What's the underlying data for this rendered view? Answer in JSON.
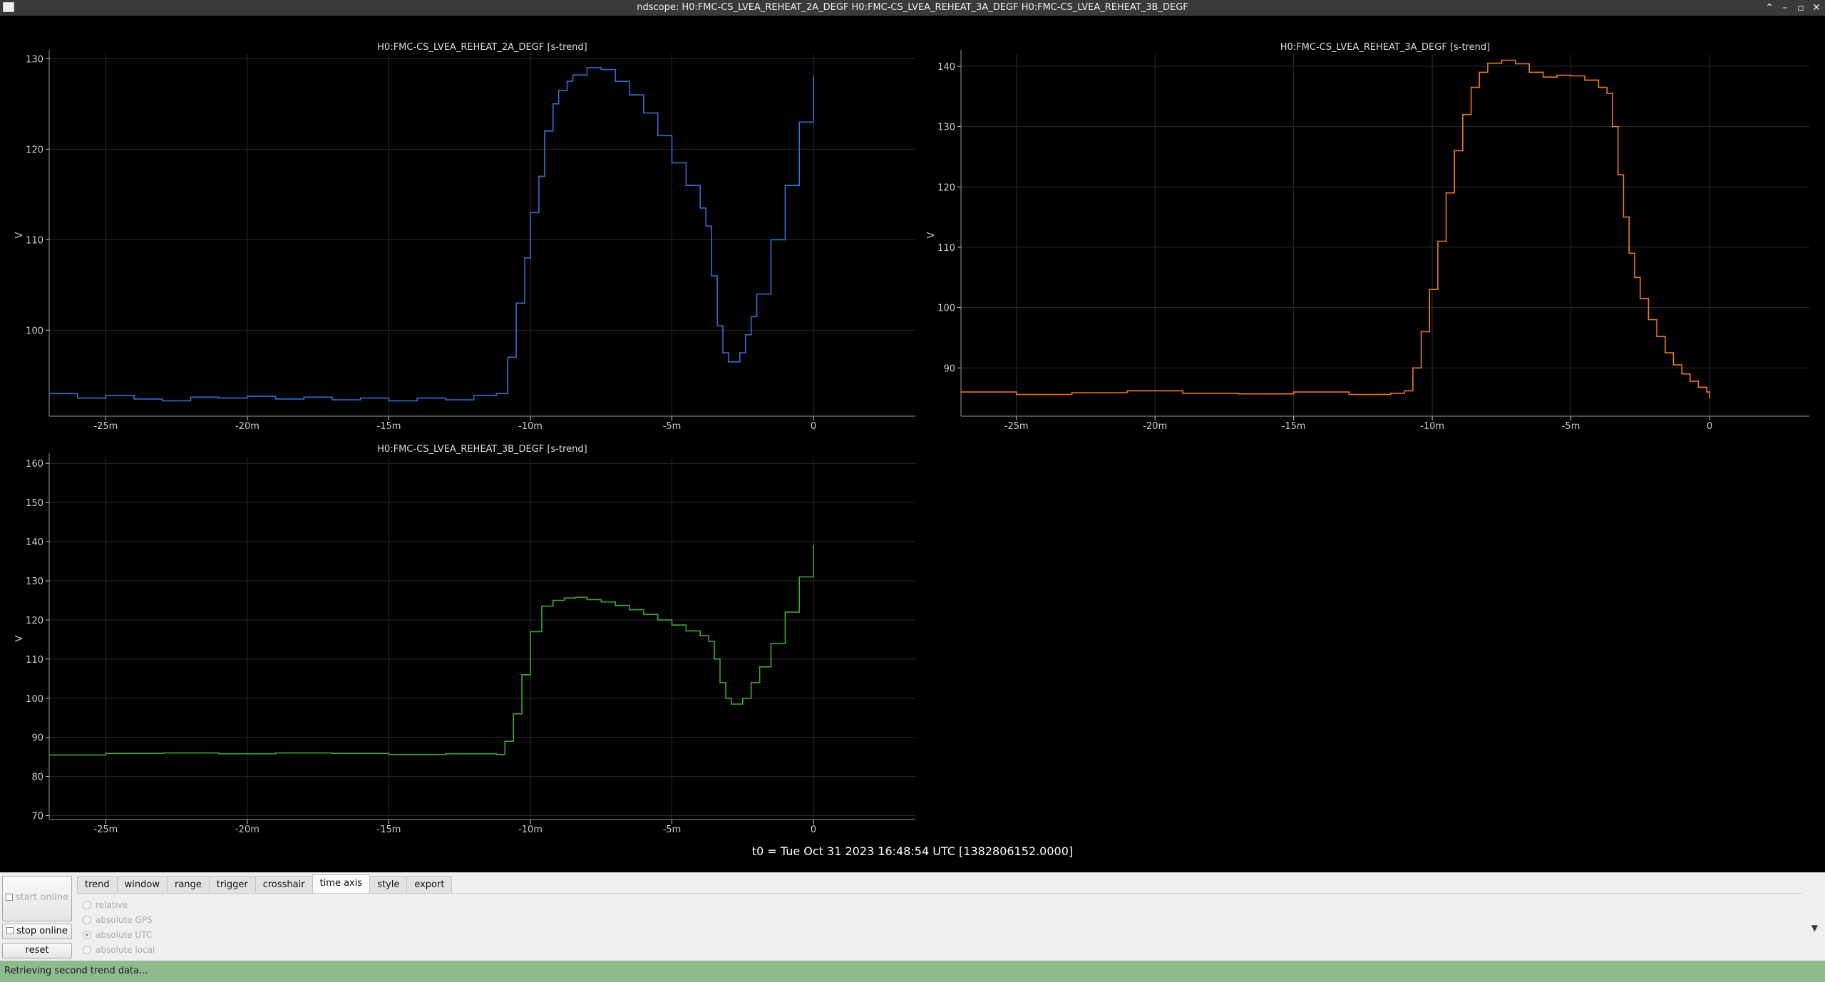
{
  "window": {
    "title": "ndscope: H0:FMC-CS_LVEA_REHEAT_2A_DEGF H0:FMC-CS_LVEA_REHEAT_3A_DEGF H0:FMC-CS_LVEA_REHEAT_3B_DEGF",
    "minimize_glyph": "–",
    "maximize_glyph": "▫",
    "close_glyph": "✕",
    "shade_glyph": "⌃"
  },
  "t0_label": "t0 = Tue Oct 31 2023 16:48:54 UTC [1382806152.0000]",
  "controls": {
    "start_online": "start online",
    "stop_online": "stop online",
    "reset": "reset",
    "tabs": [
      "trend",
      "window",
      "range",
      "trigger",
      "crosshair",
      "time axis",
      "style",
      "export"
    ],
    "active_tab": "time axis",
    "time_axis_options": [
      "relative",
      "absolute GPS",
      "absolute UTC",
      "absolute local"
    ],
    "selected_option": "absolute UTC",
    "collapse_glyph": "▼"
  },
  "status": "Retrieving second trend data...",
  "colors": {
    "plot_bg": "#000000",
    "grid": "#2a2a2a",
    "axis_text": "#cccccc",
    "trace_2a": "#2f6fd1",
    "trace_3a": "#ea7a1c",
    "trace_3b": "#3ea830",
    "status_bg": "#8fba8e"
  },
  "chart_data": [
    {
      "type": "line",
      "title": "H0:FMC-CS_LVEA_REHEAT_2A_DEGF [s-trend]",
      "ylabel": "V",
      "xlabel": "",
      "x_unit": "minutes",
      "xlim": [
        -27,
        3.6
      ],
      "ylim": [
        90.5,
        130.5
      ],
      "xticks": [
        -25,
        -20,
        -15,
        -10,
        -5,
        0
      ],
      "xtick_labels": [
        "-25m",
        "-20m",
        "-15m",
        "-10m",
        "-5m",
        "0"
      ],
      "yticks": [
        100,
        110,
        120,
        130
      ],
      "grid": true,
      "color": "#2f6fd1",
      "x": [
        -27,
        -26,
        -25,
        -24,
        -23,
        -22,
        -21,
        -20,
        -19,
        -18,
        -17,
        -16,
        -15,
        -14,
        -13,
        -12,
        -11.2,
        -10.8,
        -10.5,
        -10.2,
        -10.0,
        -9.7,
        -9.5,
        -9.2,
        -9.0,
        -8.7,
        -8.5,
        -8.0,
        -7.5,
        -7.0,
        -6.5,
        -6.0,
        -5.5,
        -5.0,
        -4.5,
        -4.0,
        -3.8,
        -3.6,
        -3.4,
        -3.2,
        -3.0,
        -2.8,
        -2.6,
        -2.4,
        -2.2,
        -2.0,
        -1.5,
        -1.0,
        -0.5,
        0
      ],
      "y": [
        93,
        92.5,
        92.8,
        92.4,
        92.2,
        92.6,
        92.5,
        92.7,
        92.4,
        92.6,
        92.3,
        92.5,
        92.2,
        92.5,
        92.3,
        92.8,
        93.0,
        97,
        103,
        108,
        113,
        117,
        122,
        125,
        126.5,
        127.5,
        128.2,
        129,
        128.8,
        127.5,
        126,
        124,
        121.5,
        118.5,
        116,
        113.5,
        111.5,
        106,
        100.5,
        97.5,
        96.5,
        96.5,
        97.5,
        99.5,
        101.5,
        104,
        110,
        116,
        123,
        128
      ]
    },
    {
      "type": "line",
      "title": "H0:FMC-CS_LVEA_REHEAT_3A_DEGF [s-trend]",
      "ylabel": "V",
      "xlabel": "",
      "x_unit": "minutes",
      "xlim": [
        -27,
        3.6
      ],
      "ylim": [
        82,
        142
      ],
      "xticks": [
        -25,
        -20,
        -15,
        -10,
        -5,
        0
      ],
      "xtick_labels": [
        "-25m",
        "-20m",
        "-15m",
        "-10m",
        "-5m",
        "0"
      ],
      "yticks": [
        90,
        100,
        110,
        120,
        130,
        140
      ],
      "grid": true,
      "color": "#ea7a1c",
      "x": [
        -27,
        -25,
        -23,
        -21,
        -19,
        -17,
        -15,
        -13,
        -11.5,
        -11.0,
        -10.7,
        -10.4,
        -10.1,
        -9.8,
        -9.5,
        -9.2,
        -8.9,
        -8.6,
        -8.3,
        -8.0,
        -7.5,
        -7.0,
        -6.5,
        -6.0,
        -5.5,
        -5.0,
        -4.5,
        -4.0,
        -3.7,
        -3.5,
        -3.3,
        -3.1,
        -2.9,
        -2.7,
        -2.5,
        -2.2,
        -1.9,
        -1.6,
        -1.3,
        -1.0,
        -0.7,
        -0.4,
        -0.1,
        0
      ],
      "y": [
        86,
        85.6,
        85.9,
        86.2,
        85.8,
        85.7,
        86.0,
        85.6,
        85.8,
        86.2,
        90,
        96,
        103,
        111,
        119,
        126,
        132,
        136.5,
        139,
        140.5,
        141,
        140.4,
        139,
        138.2,
        138.5,
        138.4,
        137.7,
        136.5,
        135.5,
        130,
        122,
        115,
        109,
        105,
        101.5,
        98,
        95.2,
        92.5,
        90.5,
        89,
        87.8,
        86.8,
        86,
        85
      ]
    },
    {
      "type": "line",
      "title": "H0:FMC-CS_LVEA_REHEAT_3B_DEGF [s-trend]",
      "ylabel": "V",
      "xlabel": "",
      "x_unit": "minutes",
      "xlim": [
        -27,
        3.6
      ],
      "ylim": [
        69,
        161.5
      ],
      "xticks": [
        -25,
        -20,
        -15,
        -10,
        -5,
        0
      ],
      "xtick_labels": [
        "-25m",
        "-20m",
        "-15m",
        "-10m",
        "-5m",
        "0"
      ],
      "yticks": [
        70,
        80,
        90,
        100,
        110,
        120,
        130,
        140,
        150,
        160
      ],
      "grid": true,
      "color": "#3ea830",
      "x": [
        -27,
        -25,
        -23,
        -21,
        -19,
        -17,
        -15,
        -13,
        -11.2,
        -10.9,
        -10.6,
        -10.3,
        -10.0,
        -9.6,
        -9.2,
        -8.8,
        -8.4,
        -8.0,
        -7.5,
        -7.0,
        -6.5,
        -6.0,
        -5.5,
        -5.0,
        -4.5,
        -4.0,
        -3.7,
        -3.5,
        -3.3,
        -3.1,
        -2.9,
        -2.7,
        -2.5,
        -2.2,
        -1.9,
        -1.5,
        -1.0,
        -0.5,
        0
      ],
      "y": [
        85.5,
        85.9,
        86.0,
        85.8,
        86.0,
        85.9,
        85.6,
        85.8,
        85.6,
        89,
        96,
        106,
        117,
        123.5,
        125,
        125.6,
        125.8,
        125.2,
        124.6,
        123.7,
        122.6,
        121.4,
        120,
        118.7,
        117.2,
        116,
        114.5,
        110,
        104,
        100,
        98.5,
        98.5,
        100,
        104,
        108,
        114,
        122,
        131,
        139
      ]
    }
  ]
}
